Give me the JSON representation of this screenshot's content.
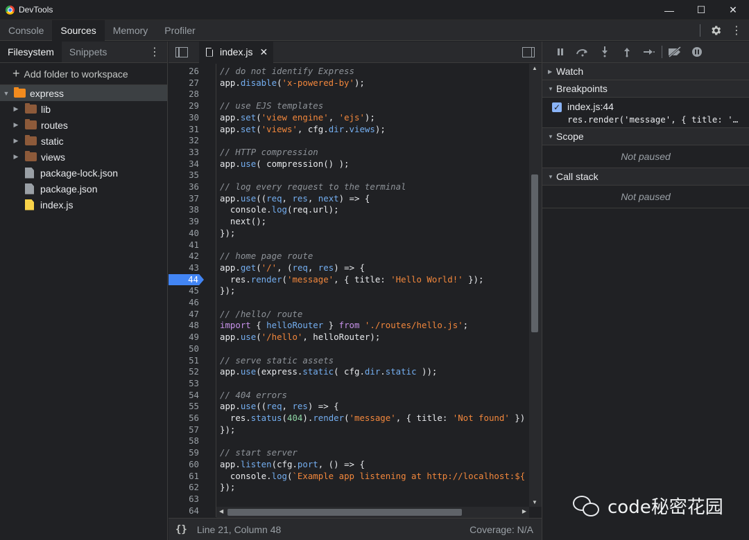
{
  "window": {
    "title": "DevTools",
    "minimize": "—",
    "maximize": "☐",
    "close": "✕"
  },
  "main_tabs": [
    "Console",
    "Sources",
    "Memory",
    "Profiler"
  ],
  "navigator": {
    "tabs": [
      "Filesystem",
      "Snippets"
    ],
    "add_folder": "Add folder to workspace",
    "tree": [
      {
        "label": "express",
        "type": "folder-root"
      },
      {
        "label": "lib",
        "type": "folder"
      },
      {
        "label": "routes",
        "type": "folder"
      },
      {
        "label": "static",
        "type": "folder"
      },
      {
        "label": "views",
        "type": "folder"
      },
      {
        "label": "package-lock.json",
        "type": "file"
      },
      {
        "label": "package.json",
        "type": "file"
      },
      {
        "label": "index.js",
        "type": "js"
      }
    ]
  },
  "editor": {
    "tab_label": "index.js",
    "breakpoint_line": 44,
    "lines": [
      {
        "n": 26,
        "c": [
          [
            "c",
            "// do not identify Express"
          ]
        ]
      },
      {
        "n": 27,
        "c": [
          [
            "t",
            "app."
          ],
          [
            "p",
            "disable"
          ],
          [
            "t",
            "("
          ],
          [
            "s",
            "'x-powered-by'"
          ],
          [
            "t",
            ");"
          ]
        ]
      },
      {
        "n": 28,
        "c": []
      },
      {
        "n": 29,
        "c": [
          [
            "c",
            "// use EJS templates"
          ]
        ]
      },
      {
        "n": 30,
        "c": [
          [
            "t",
            "app."
          ],
          [
            "p",
            "set"
          ],
          [
            "t",
            "("
          ],
          [
            "s",
            "'view engine'"
          ],
          [
            "t",
            ", "
          ],
          [
            "s",
            "'ejs'"
          ],
          [
            "t",
            ");"
          ]
        ]
      },
      {
        "n": 31,
        "c": [
          [
            "t",
            "app."
          ],
          [
            "p",
            "set"
          ],
          [
            "t",
            "("
          ],
          [
            "s",
            "'views'"
          ],
          [
            "t",
            ", cfg."
          ],
          [
            "p",
            "dir"
          ],
          [
            "t",
            "."
          ],
          [
            "p",
            "views"
          ],
          [
            "t",
            ");"
          ]
        ]
      },
      {
        "n": 32,
        "c": []
      },
      {
        "n": 33,
        "c": [
          [
            "c",
            "// HTTP compression"
          ]
        ]
      },
      {
        "n": 34,
        "c": [
          [
            "t",
            "app."
          ],
          [
            "p",
            "use"
          ],
          [
            "t",
            "( compression() );"
          ]
        ]
      },
      {
        "n": 35,
        "c": []
      },
      {
        "n": 36,
        "c": [
          [
            "c",
            "// log every request to the terminal"
          ]
        ]
      },
      {
        "n": 37,
        "c": [
          [
            "t",
            "app."
          ],
          [
            "p",
            "use"
          ],
          [
            "t",
            "(("
          ],
          [
            "v",
            "req"
          ],
          [
            "t",
            ", "
          ],
          [
            "v",
            "res"
          ],
          [
            "t",
            ", "
          ],
          [
            "v",
            "next"
          ],
          [
            "t",
            ") => {"
          ]
        ]
      },
      {
        "n": 38,
        "c": [
          [
            "t",
            "  console."
          ],
          [
            "p",
            "log"
          ],
          [
            "t",
            "(req.url);"
          ]
        ]
      },
      {
        "n": 39,
        "c": [
          [
            "t",
            "  next();"
          ]
        ]
      },
      {
        "n": 40,
        "c": [
          [
            "t",
            "});"
          ]
        ]
      },
      {
        "n": 41,
        "c": []
      },
      {
        "n": 42,
        "c": [
          [
            "c",
            "// home page route"
          ]
        ]
      },
      {
        "n": 43,
        "c": [
          [
            "t",
            "app."
          ],
          [
            "p",
            "get"
          ],
          [
            "t",
            "("
          ],
          [
            "s",
            "'/'"
          ],
          [
            "t",
            ", ("
          ],
          [
            "v",
            "req"
          ],
          [
            "t",
            ", "
          ],
          [
            "v",
            "res"
          ],
          [
            "t",
            ") => {"
          ]
        ]
      },
      {
        "n": 44,
        "c": [
          [
            "t",
            "  res."
          ],
          [
            "p",
            "render"
          ],
          [
            "t",
            "("
          ],
          [
            "s",
            "'message'"
          ],
          [
            "t",
            ", { title: "
          ],
          [
            "s",
            "'Hello World!'"
          ],
          [
            "t",
            " });"
          ]
        ]
      },
      {
        "n": 45,
        "c": [
          [
            "t",
            "});"
          ]
        ]
      },
      {
        "n": 46,
        "c": []
      },
      {
        "n": 47,
        "c": [
          [
            "c",
            "// /hello/ route"
          ]
        ]
      },
      {
        "n": 48,
        "c": [
          [
            "k",
            "import"
          ],
          [
            "t",
            " { "
          ],
          [
            "v",
            "helloRouter"
          ],
          [
            "t",
            " } "
          ],
          [
            "k",
            "from"
          ],
          [
            "t",
            " "
          ],
          [
            "s",
            "'./routes/hello.js'"
          ],
          [
            "t",
            ";"
          ]
        ]
      },
      {
        "n": 49,
        "c": [
          [
            "t",
            "app."
          ],
          [
            "p",
            "use"
          ],
          [
            "t",
            "("
          ],
          [
            "s",
            "'/hello'"
          ],
          [
            "t",
            ", helloRouter);"
          ]
        ]
      },
      {
        "n": 50,
        "c": []
      },
      {
        "n": 51,
        "c": [
          [
            "c",
            "// serve static assets"
          ]
        ]
      },
      {
        "n": 52,
        "c": [
          [
            "t",
            "app."
          ],
          [
            "p",
            "use"
          ],
          [
            "t",
            "(express."
          ],
          [
            "p",
            "static"
          ],
          [
            "t",
            "( cfg."
          ],
          [
            "p",
            "dir"
          ],
          [
            "t",
            "."
          ],
          [
            "p",
            "static"
          ],
          [
            "t",
            " ));"
          ]
        ]
      },
      {
        "n": 53,
        "c": []
      },
      {
        "n": 54,
        "c": [
          [
            "c",
            "// 404 errors"
          ]
        ]
      },
      {
        "n": 55,
        "c": [
          [
            "t",
            "app."
          ],
          [
            "p",
            "use"
          ],
          [
            "t",
            "(("
          ],
          [
            "v",
            "req"
          ],
          [
            "t",
            ", "
          ],
          [
            "v",
            "res"
          ],
          [
            "t",
            ") => {"
          ]
        ]
      },
      {
        "n": 56,
        "c": [
          [
            "t",
            "  res."
          ],
          [
            "p",
            "status"
          ],
          [
            "t",
            "("
          ],
          [
            "n",
            "404"
          ],
          [
            "t",
            ")."
          ],
          [
            "p",
            "render"
          ],
          [
            "t",
            "("
          ],
          [
            "s",
            "'message'"
          ],
          [
            "t",
            ", { title: "
          ],
          [
            "s",
            "'Not found'"
          ],
          [
            "t",
            " })"
          ]
        ]
      },
      {
        "n": 57,
        "c": [
          [
            "t",
            "});"
          ]
        ]
      },
      {
        "n": 58,
        "c": []
      },
      {
        "n": 59,
        "c": [
          [
            "c",
            "// start server"
          ]
        ]
      },
      {
        "n": 60,
        "c": [
          [
            "t",
            "app."
          ],
          [
            "p",
            "listen"
          ],
          [
            "t",
            "(cfg."
          ],
          [
            "p",
            "port"
          ],
          [
            "t",
            ", () => {"
          ]
        ]
      },
      {
        "n": 61,
        "c": [
          [
            "t",
            "  console."
          ],
          [
            "p",
            "log"
          ],
          [
            "t",
            "("
          ],
          [
            "s",
            "`Example app listening at http://localhost:${"
          ]
        ]
      },
      {
        "n": 62,
        "c": [
          [
            "t",
            "});"
          ]
        ]
      },
      {
        "n": 63,
        "c": []
      },
      {
        "n": 64,
        "c": []
      }
    ]
  },
  "status_bar": {
    "braces": "{}",
    "position": "Line 21, Column 48",
    "coverage": "Coverage: N/A"
  },
  "debugger": {
    "watch": "Watch",
    "breakpoints": "Breakpoints",
    "breakpoint_item": {
      "label": "index.js:44",
      "code": "res.render('message', { title: '…"
    },
    "scope": "Scope",
    "scope_status": "Not paused",
    "call_stack": "Call stack",
    "call_stack_status": "Not paused"
  },
  "watermark": "code秘密花园",
  "icons": [
    "chrome-logo-icon",
    "minimize-icon",
    "maximize-icon",
    "close-icon",
    "gear-icon",
    "kebab-menu-icon",
    "plus-icon",
    "folder-icon",
    "file-icon",
    "pause-icon",
    "step-over-icon",
    "step-into-icon",
    "step-out-icon",
    "step-icon",
    "deactivate-breakpoints-icon",
    "pause-on-exceptions-icon"
  ]
}
